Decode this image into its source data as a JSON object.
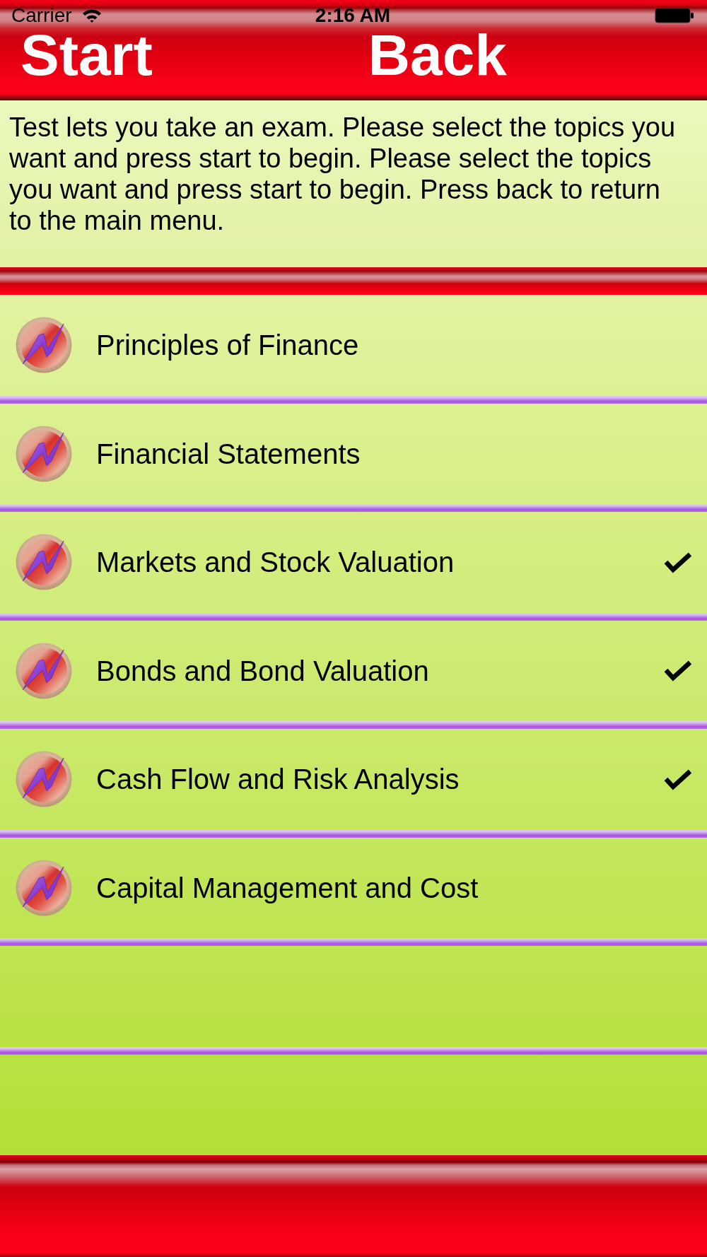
{
  "status_bar": {
    "carrier": "Carrier",
    "time": "2:16 AM"
  },
  "toolbar": {
    "buttons": [
      {
        "label": "Start"
      },
      {
        "label": "Back"
      }
    ]
  },
  "description": "Test lets you take an exam. Please select the topics you want and press start to begin. Please select the topics you want and press start to begin. Press back to return to the main menu.",
  "topics": [
    {
      "label": "Principles of Finance",
      "checked": false
    },
    {
      "label": "Financial Statements",
      "checked": false
    },
    {
      "label": "Markets and Stock Valuation",
      "checked": true
    },
    {
      "label": "Bonds and Bond Valuation",
      "checked": true
    },
    {
      "label": "Cash Flow and Risk Analysis",
      "checked": true
    },
    {
      "label": "Capital Management and Cost",
      "checked": false
    }
  ]
}
